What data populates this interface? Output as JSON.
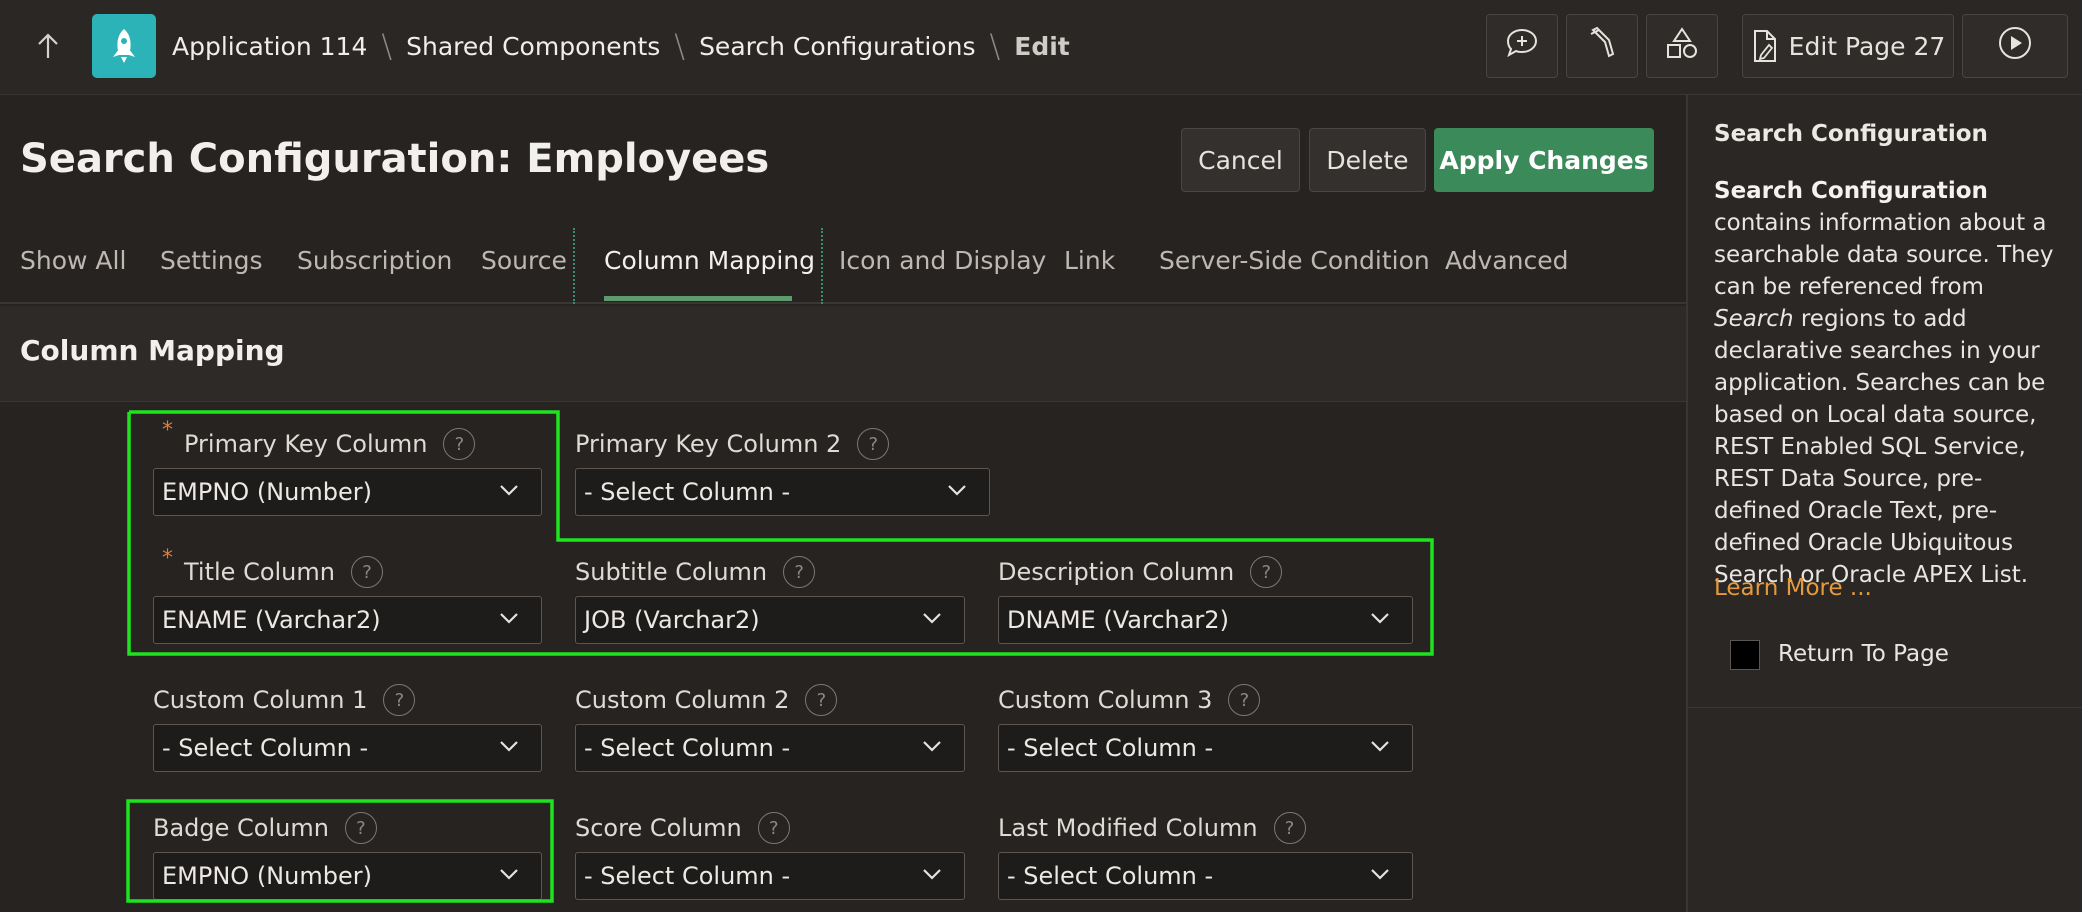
{
  "topbar": {
    "breadcrumbs": [
      "Application 114",
      "Shared Components",
      "Search Configurations"
    ],
    "current": "Edit",
    "buttons": {
      "edit_page": "Edit Page 27"
    },
    "icons": [
      "arrow-up-icon",
      "rocket-icon",
      "comment-plus-icon",
      "wand-icon",
      "shapes-icon",
      "document-edit-icon",
      "play-icon"
    ]
  },
  "header": {
    "title": "Search Configuration: Employees",
    "cancel": "Cancel",
    "delete": "Delete",
    "apply": "Apply Changes"
  },
  "tabs": [
    {
      "label": "Show All"
    },
    {
      "label": "Settings"
    },
    {
      "label": "Subscription"
    },
    {
      "label": "Source"
    },
    {
      "label": "Column Mapping"
    },
    {
      "label": "Icon and Display"
    },
    {
      "label": "Link"
    },
    {
      "label": "Server-Side Condition"
    },
    {
      "label": "Advanced"
    }
  ],
  "section": {
    "title": "Column Mapping",
    "fields": {
      "primary_key": {
        "label": "Primary Key Column",
        "value": "EMPNO (Number)"
      },
      "primary_key2": {
        "label": "Primary Key Column 2",
        "value": "- Select Column -"
      },
      "title": {
        "label": "Title Column",
        "value": "ENAME (Varchar2)"
      },
      "subtitle": {
        "label": "Subtitle Column",
        "value": "JOB (Varchar2)"
      },
      "description": {
        "label": "Description Column",
        "value": "DNAME (Varchar2)"
      },
      "custom1": {
        "label": "Custom Column 1",
        "value": "- Select Column -"
      },
      "custom2": {
        "label": "Custom Column 2",
        "value": "- Select Column -"
      },
      "custom3": {
        "label": "Custom Column 3",
        "value": "- Select Column -"
      },
      "badge": {
        "label": "Badge Column",
        "value": "EMPNO (Number)"
      },
      "score": {
        "label": "Score Column",
        "value": "- Select Column -"
      },
      "last_modified": {
        "label": "Last Modified Column",
        "value": "- Select Column -"
      }
    },
    "required_mark": "*",
    "help_glyph": "?"
  },
  "help_panel": {
    "title": "Search Configuration",
    "text_bold": "Search Configuration",
    "text_1": " contains information about a searchable data source. They can be referenced from ",
    "text_italic": "Search",
    "text_2": " regions to add declarative searches in your application. Searches can be based on Local data source, REST Enabled SQL Service, REST Data Source, pre-defined Oracle Text, pre-defined Oracle Ubiquitous Search or Oracle APEX List.",
    "learn_more": "Learn More ...",
    "return_to_page": "Return To Page"
  },
  "colors": {
    "background": "#262321",
    "primary_button": "#3b8a59",
    "highlight": "#1fe31f",
    "app_logo": "#2bb3b8",
    "link": "#e59a3e",
    "required": "#e07b39"
  }
}
